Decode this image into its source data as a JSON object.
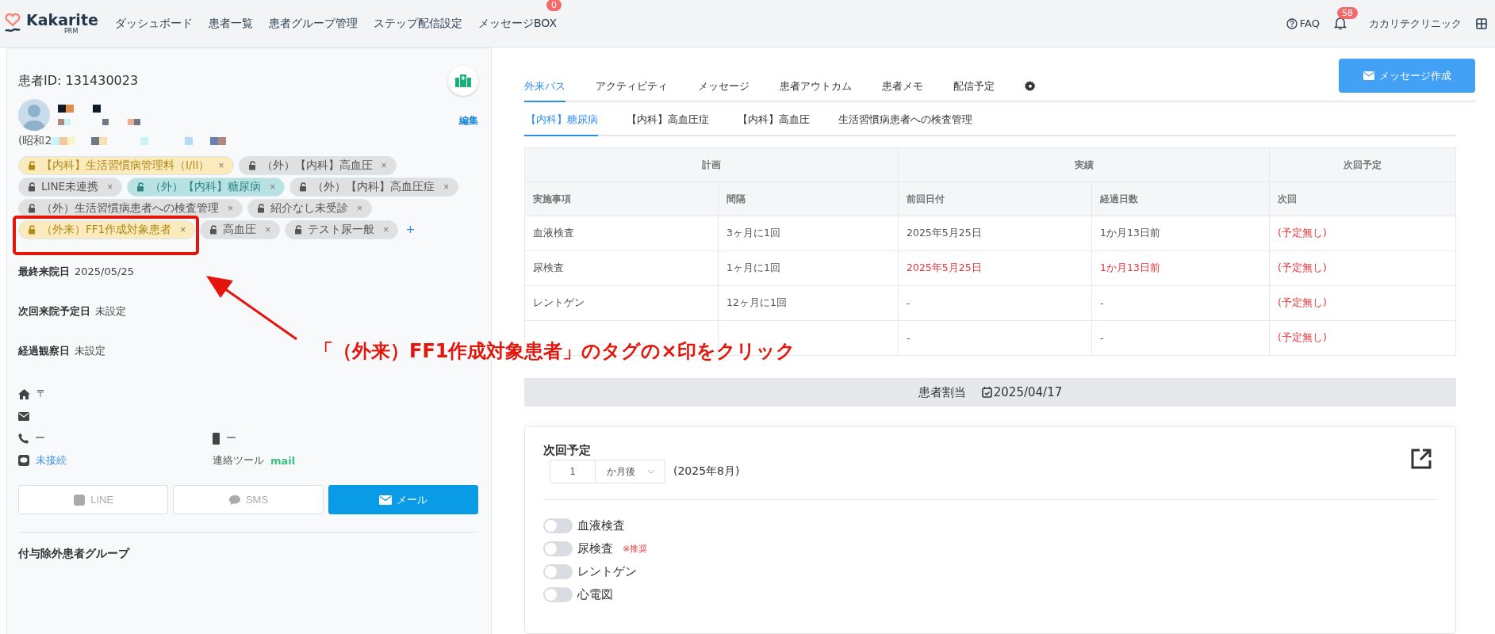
{
  "nav": {
    "logo": "Kakarite",
    "logo_sub": "PRM",
    "items": [
      {
        "label": "ダッシュボード"
      },
      {
        "label": "患者一覧"
      },
      {
        "label": "患者グループ管理"
      },
      {
        "label": "ステップ配信設定"
      },
      {
        "label": "メッセージBOX",
        "badge": "0"
      }
    ],
    "faq": "FAQ",
    "notification_count": "58",
    "clinic": "カカリテクリニック"
  },
  "patient": {
    "id_label": "患者ID: 131430023",
    "birth_prefix": "(昭和2",
    "edit": "編集",
    "tag_remove_mark": "×",
    "add_tag_mark": "+",
    "tags": [
      {
        "label": "【内科】生活習慣病管理料（I/II）",
        "color": "#fbeabb"
      },
      {
        "label": "（外）【内科】高血圧",
        "color": "#e0e0e0"
      },
      {
        "label": "LINE未連携",
        "color": "#e0e0e0"
      },
      {
        "label": "（外）【内科】糖尿病",
        "color": "#b8e2e2"
      },
      {
        "label": "（外）【内科】高血圧症",
        "color": "#e0e0e0"
      },
      {
        "label": "（外）生活習慣病患者への検査管理",
        "color": "#e0e0e0"
      },
      {
        "label": "紹介なし未受診",
        "color": "#e0e0e0"
      },
      {
        "label": "（外来）FF1作成対象患者",
        "color": "#fbeabb",
        "highlighted": true
      },
      {
        "label": "高血圧",
        "color": "#e0e0e0"
      },
      {
        "label": "テスト尿一般",
        "color": "#e0e0e0"
      }
    ],
    "dates": [
      {
        "label": "最終来院日",
        "value": "2025/05/25"
      },
      {
        "label": "次回来院予定日",
        "value": "未設定"
      },
      {
        "label": "経過観察日",
        "value": "未設定"
      }
    ],
    "postal_mark": "〒",
    "phone": "ー",
    "mobile": "ー",
    "line_status": "未接続",
    "contact_tool_label": "連絡ツール",
    "contact_tool": "mail",
    "channels": [
      {
        "kind": "line",
        "label": "LINE",
        "selected": false
      },
      {
        "kind": "sms",
        "label": "SMS",
        "selected": false
      },
      {
        "kind": "mail",
        "label": "メール",
        "selected": true
      }
    ],
    "excluded_groups_title": "付与除外患者グループ"
  },
  "tabs": [
    {
      "label": "外来パス",
      "selected": true
    },
    {
      "label": "アクティビティ",
      "selected": false
    },
    {
      "label": "メッセージ",
      "selected": false
    },
    {
      "label": "患者アウトカム",
      "selected": false
    },
    {
      "label": "患者メモ",
      "selected": false
    },
    {
      "label": "配信予定",
      "selected": false
    }
  ],
  "compose_button": "メッセージ作成",
  "subtabs": [
    {
      "label": "【内科】糖尿病",
      "selected": true
    },
    {
      "label": "【内科】高血圧症",
      "selected": false
    },
    {
      "label": "【内科】高血圧",
      "selected": false
    },
    {
      "label": "生活習慣病患者への検査管理",
      "selected": false
    }
  ],
  "table": {
    "groups": [
      "計画",
      "実績",
      "次回予定"
    ],
    "columns": [
      "実施事項",
      "間隔",
      "前回日付",
      "経過日数",
      "次回"
    ],
    "rows": [
      {
        "cells": [
          "血液検査",
          "3ヶ月に1回",
          "2025年5月25日",
          "1か月13日前",
          "(予定無し)"
        ],
        "alert": false
      },
      {
        "cells": [
          "尿検査",
          "1ヶ月に1回",
          "2025年5月25日",
          "1か月13日前",
          "(予定無し)"
        ],
        "alert": true
      },
      {
        "cells": [
          "レントゲン",
          "12ヶ月に1回",
          "-",
          "-",
          "(予定無し)"
        ],
        "alert": false
      },
      {
        "cells": [
          null,
          null,
          "-",
          "-",
          "(予定無し)"
        ],
        "alert": false
      }
    ]
  },
  "assignment": {
    "label": "患者割当",
    "date": "2025/04/17"
  },
  "next_plan": {
    "title": "次回予定",
    "amount": "1",
    "unit": "か月後",
    "month": "(2025年8月)",
    "items": [
      {
        "label": "血液検査",
        "on": false
      },
      {
        "label": "尿検査",
        "on": false,
        "note": "※推奨"
      },
      {
        "label": "レントゲン",
        "on": false
      },
      {
        "label": "心電図",
        "on": false
      }
    ]
  },
  "annotation": {
    "text": "「（外来）FF1作成対象患者」のタグの×印をクリック"
  }
}
